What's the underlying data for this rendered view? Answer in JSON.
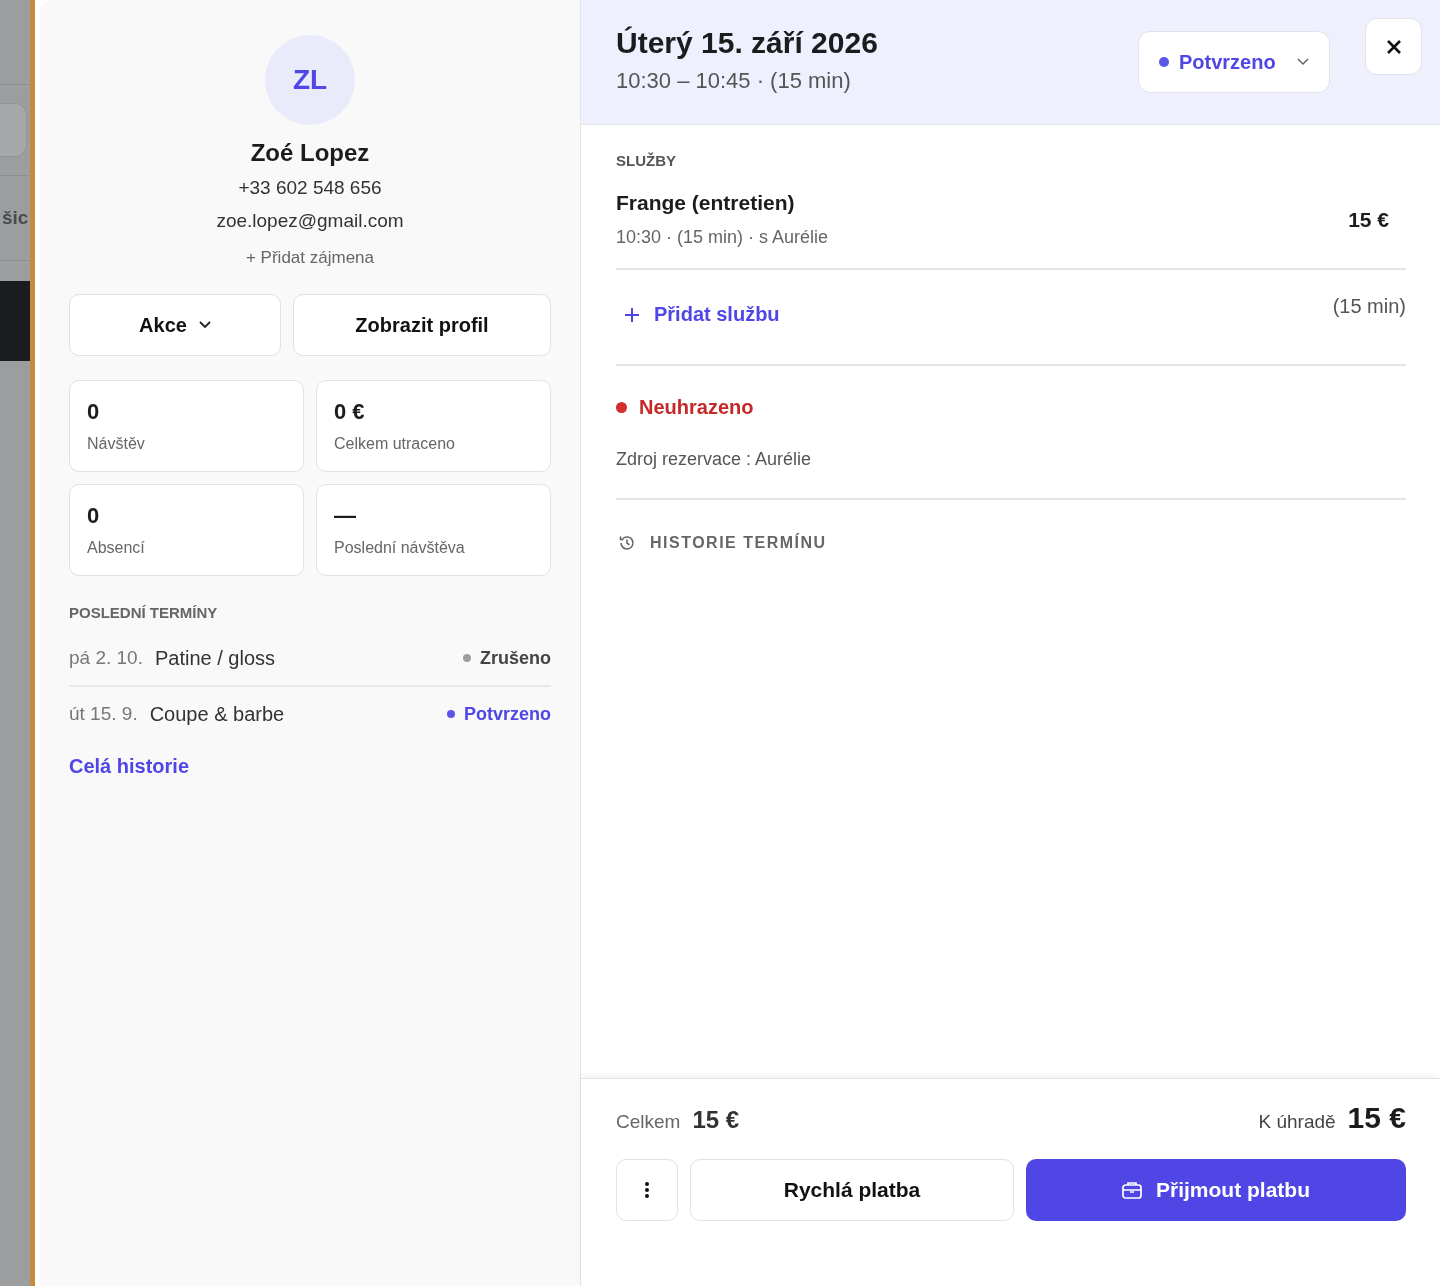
{
  "background": {
    "text": "šic"
  },
  "client": {
    "initials": "ZL",
    "name": "Zoé Lopez",
    "phone": "+33 602 548 656",
    "email": "zoe.lopez@gmail.com",
    "add_pronouns": "+ Přidat zájmena",
    "actions": [
      {
        "label": "Akce",
        "kind": "dropdown"
      },
      {
        "label": "Zobrazit profil",
        "kind": "plain"
      }
    ],
    "stats": [
      {
        "value": "0",
        "label": "Návštěv"
      },
      {
        "value": "0 €",
        "label": "Celkem utraceno"
      },
      {
        "value": "0",
        "label": "Absencí"
      },
      {
        "value": "—",
        "label": "Poslední návštěva"
      }
    ],
    "recent_title": "POSLEDNÍ TERMÍNY",
    "recent": [
      {
        "date": "pá 2. 10.",
        "service": "Patine / gloss",
        "status": "Zrušeno",
        "kind": "cancelled",
        "color": "#9e9e9e"
      },
      {
        "date": "út 15. 9.",
        "service": "Coupe & barbe",
        "status": "Potvrzeno",
        "kind": "confirmed",
        "color": "#5b55e8"
      }
    ],
    "history_link": "Celá historie"
  },
  "appointment": {
    "date": "Úterý 15. září 2026",
    "time": "10:30 – 10:45 · (15 min)",
    "status": {
      "label": "Potvrzeno",
      "color": "#5b55e8"
    },
    "services_title": "SLUŽBY",
    "services": [
      {
        "name": "Frange (entretien)",
        "details": "10:30 · (15 min) · s Aurélie",
        "price": "15 €"
      }
    ],
    "add_service": {
      "label": "Přidat službu",
      "duration": "(15 min)"
    },
    "payment_status": {
      "label": "Neuhrazeno",
      "color": "#d32f2f"
    },
    "source": "Zdroj rezervace : Aurélie",
    "history": "HISTORIE TERMÍNU"
  },
  "footer": {
    "total_label": "Celkem",
    "total": "15 €",
    "due_label": "K úhradě",
    "due": "15 €",
    "buttons": [
      {
        "label": "Rychlá platba",
        "kind": "secondary"
      },
      {
        "label": "Přijmout platbu",
        "kind": "primary"
      }
    ]
  }
}
